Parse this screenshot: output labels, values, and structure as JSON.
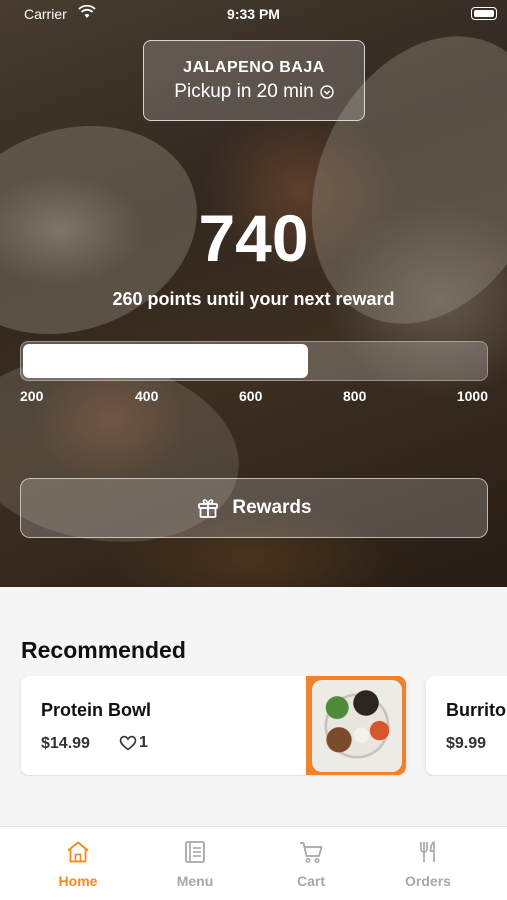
{
  "status_bar": {
    "carrier": "Carrier",
    "time": "9:33 PM"
  },
  "location": {
    "name": "JALAPENO BAJA",
    "eta": "Pickup in 20 min"
  },
  "rewards": {
    "points": "740",
    "until_text": "260 points until your next reward",
    "progress_fraction": 0.62,
    "ticks": [
      "200",
      "400",
      "600",
      "800",
      "1000"
    ],
    "button_label": "Rewards"
  },
  "recommended": {
    "title": "Recommended",
    "items": [
      {
        "name": "Protein Bowl",
        "price": "$14.99",
        "likes": "1"
      },
      {
        "name": "Burrito",
        "price": "$9.99"
      }
    ]
  },
  "tabs": [
    {
      "label": "Home",
      "icon": "home-icon",
      "active": true
    },
    {
      "label": "Menu",
      "icon": "menu-icon",
      "active": false
    },
    {
      "label": "Cart",
      "icon": "cart-icon",
      "active": false
    },
    {
      "label": "Orders",
      "icon": "fork-knife-icon",
      "active": false
    }
  ],
  "colors": {
    "accent": "#f28a1a",
    "tab_inactive": "#a8a8a8"
  }
}
